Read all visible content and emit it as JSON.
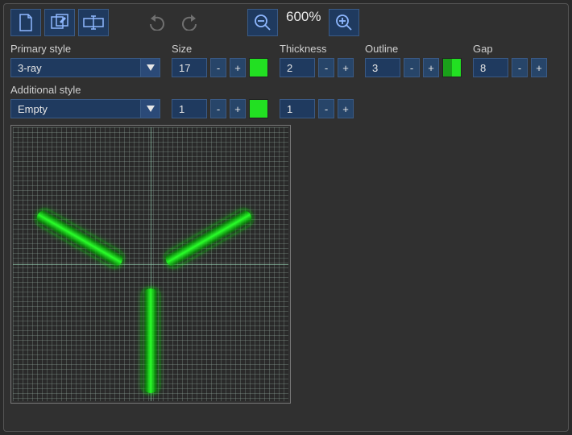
{
  "zoom": {
    "label": "600%"
  },
  "labels": {
    "primary_style": "Primary style",
    "additional_style": "Additional style",
    "size": "Size",
    "thickness": "Thickness",
    "outline": "Outline",
    "gap": "Gap"
  },
  "primary": {
    "style": "3-ray",
    "size": "17",
    "size_color": "#22e022",
    "thickness": "2",
    "outline": "3",
    "outline_color_a": "#1aa01a",
    "outline_color_b": "#22e022",
    "gap": "8"
  },
  "additional": {
    "style": "Empty",
    "size": "1",
    "size_color": "#22e022",
    "thickness": "1"
  },
  "icons": {
    "new": "new-document-icon",
    "edit": "edit-layers-icon",
    "rename": "rename-icon",
    "undo": "undo-icon",
    "redo": "redo-icon",
    "zoom_out": "zoom-out-icon",
    "zoom_in": "zoom-in-icon",
    "minus": "-",
    "plus": "+"
  }
}
